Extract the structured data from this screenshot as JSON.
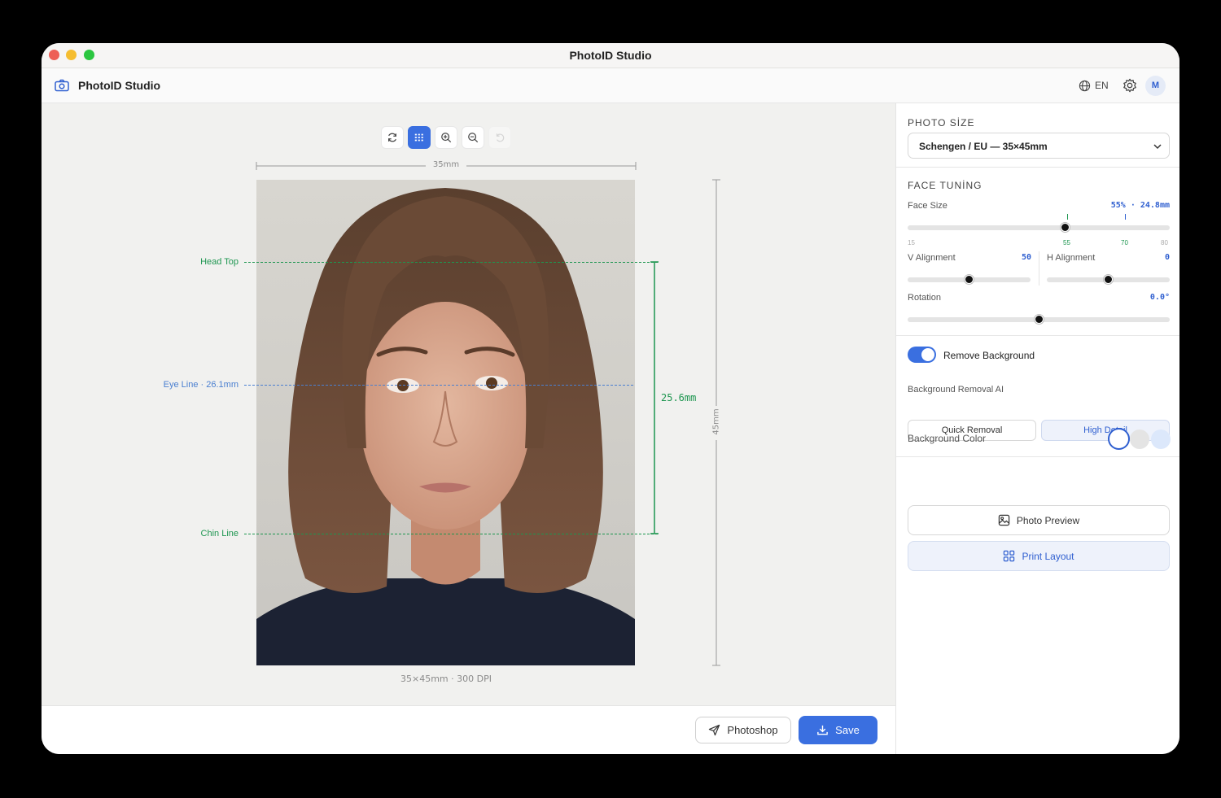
{
  "window": {
    "title": "PhotoID Studio"
  },
  "header": {
    "app_name": "PhotoID Studio",
    "language": "EN",
    "avatar_initial": "M"
  },
  "toolbar": {
    "tools": [
      "refresh-icon",
      "grid-icon",
      "zoom-in-icon",
      "zoom-out-icon",
      "undo-icon"
    ],
    "active": "grid-icon"
  },
  "canvas": {
    "width_label": "35mm",
    "height_label": "45mm",
    "footer_label": "35×45mm · 300 DPI",
    "guides": {
      "head_top": "Head Top",
      "eye_line": "Eye Line · 26.1mm",
      "chin_line": "Chin Line"
    },
    "face_measure": "25.6mm"
  },
  "actions": {
    "photoshop": "Photoshop",
    "save": "Save"
  },
  "sidebar": {
    "photo_size": {
      "title": "PHOTO SİZE",
      "selected": "Schengen / EU — 35×45mm"
    },
    "face_tuning": {
      "title": "FACE TUNİNG",
      "face_size": {
        "label": "Face Size",
        "value": "55% · 24.8mm",
        "level": 0.6,
        "ticks": [
          "15",
          "55",
          "70",
          "80"
        ]
      },
      "v_alignment": {
        "label": "V Alignment",
        "value": "50",
        "level": 0.5
      },
      "h_alignment": {
        "label": "H Alignment",
        "value": "0",
        "level": 0.5
      },
      "rotation": {
        "label": "Rotation",
        "value": "0.0°",
        "level": 0.5
      }
    },
    "remove_background": {
      "label": "Remove Background",
      "enabled": true
    },
    "bg_removal_ai": {
      "label": "Background Removal AI",
      "options": [
        "Quick Removal",
        "High Detail"
      ],
      "selected": "High Detail"
    },
    "background_color": {
      "label": "Background Color",
      "colors": [
        "#ffffff",
        "#e4e4e4",
        "#dce8fb"
      ]
    },
    "photo_preview": "Photo Preview",
    "print_layout": "Print Layout"
  },
  "colors": {
    "accent": "#3a6fe0",
    "guide_green": "#1e9650",
    "guide_blue": "#4a7fd0"
  }
}
